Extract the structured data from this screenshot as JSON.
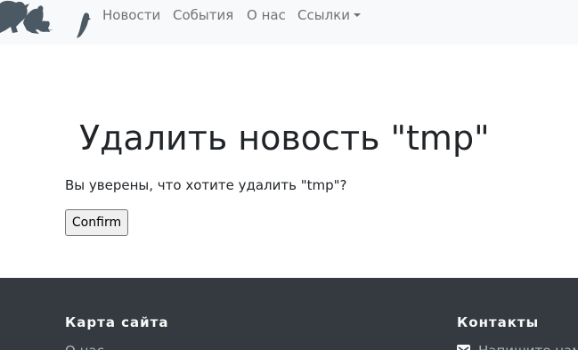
{
  "navbar": {
    "logo_icon": "birds-logo-icon",
    "items": [
      {
        "label": "Новости"
      },
      {
        "label": "События"
      },
      {
        "label": "О нас"
      },
      {
        "label": "Ссылки",
        "dropdown": true
      }
    ]
  },
  "main": {
    "title": "Удалить новость \"tmp\"",
    "question": "Вы уверены, что хотите удалить \"tmp\"?",
    "confirm_label": "Confirm"
  },
  "footer": {
    "sitemap": {
      "heading": "Карта сайта",
      "first_link": "О нас"
    },
    "contacts": {
      "heading": "Контакты",
      "first_link": "Напишите нам",
      "first_link_icon": "envelope-icon"
    }
  },
  "colors": {
    "navbar_bg": "#f8f9fa",
    "footer_bg": "#343a40",
    "text": "#212529"
  }
}
